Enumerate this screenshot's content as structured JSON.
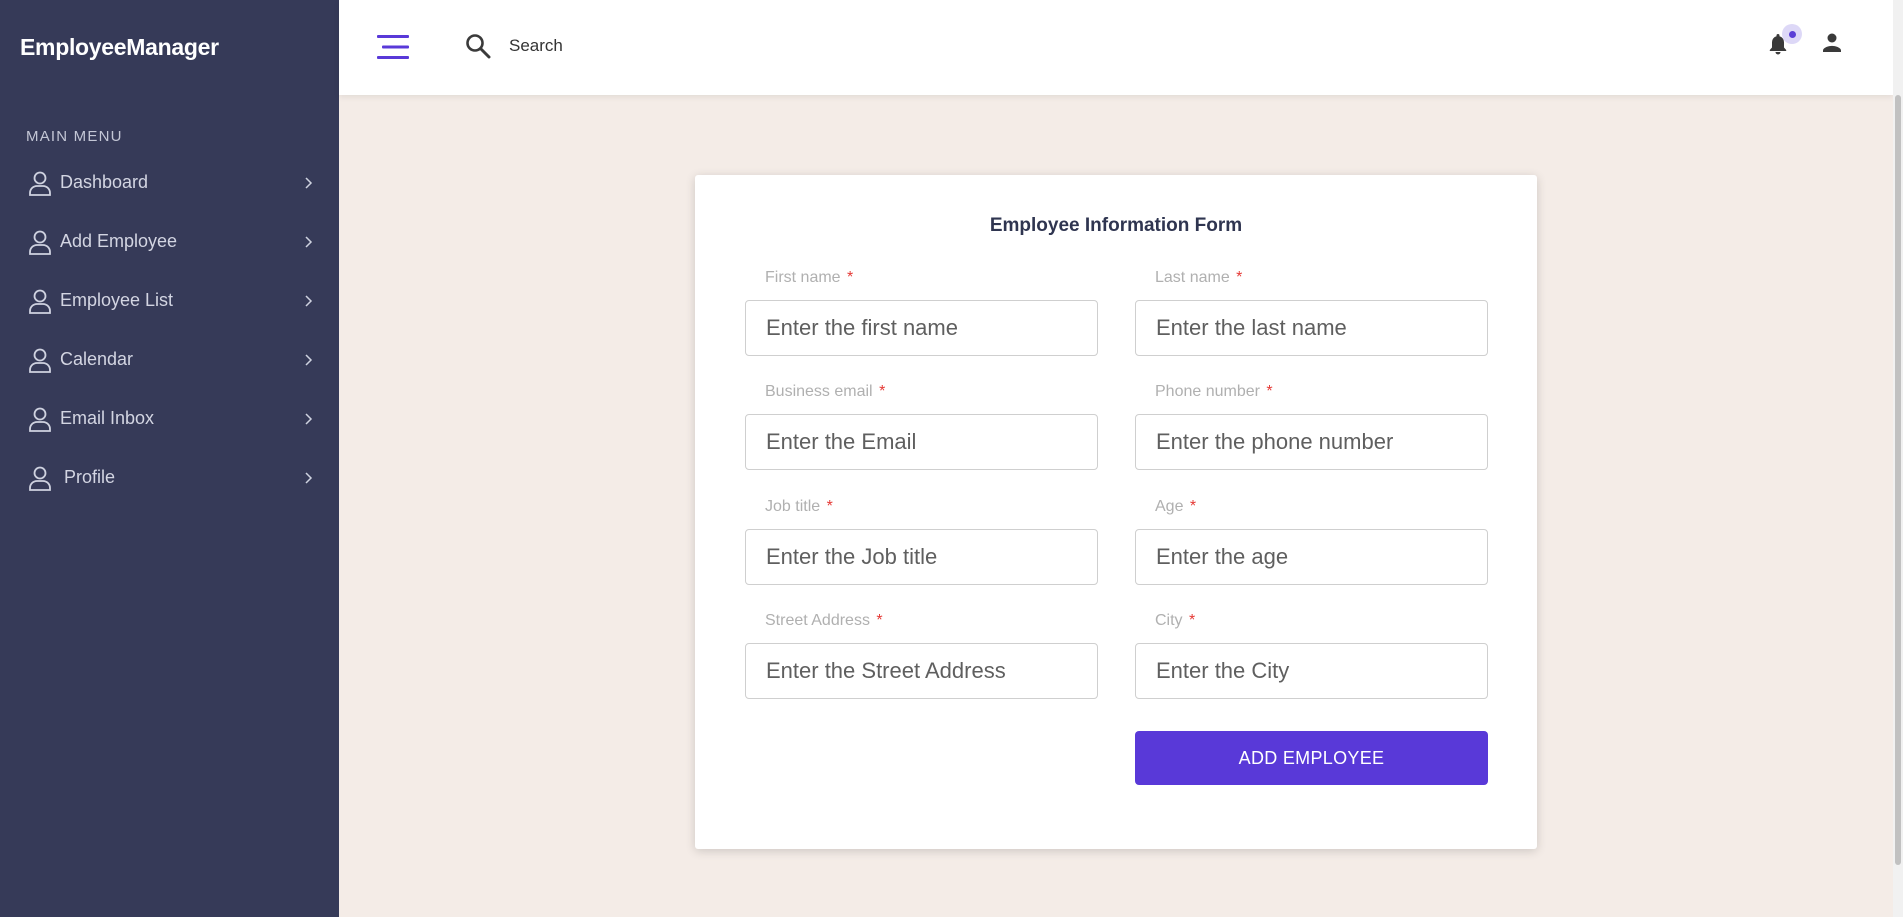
{
  "app": {
    "brand": "EmployeeManager"
  },
  "sidebar": {
    "heading": "MAIN MENU",
    "items": [
      {
        "label": "Dashboard",
        "icon": "user-icon"
      },
      {
        "label": "Add Employee",
        "icon": "user-icon"
      },
      {
        "label": "Employee List",
        "icon": "user-icon"
      },
      {
        "label": "Calendar",
        "icon": "user-icon"
      },
      {
        "label": "Email Inbox",
        "icon": "user-icon"
      },
      {
        "label": "Profile",
        "icon": "user-icon"
      }
    ]
  },
  "header": {
    "search_placeholder": "Search",
    "icons": [
      "menu-icon",
      "search-icon",
      "bell-icon",
      "person-icon"
    ]
  },
  "form": {
    "title": "Employee Information Form",
    "required_marker": "*",
    "fields": [
      {
        "label": "First name",
        "placeholder": "Enter the first name",
        "value": ""
      },
      {
        "label": "Last name",
        "placeholder": "Enter the last name",
        "value": ""
      },
      {
        "label": "Business email",
        "placeholder": "Enter the Email",
        "value": ""
      },
      {
        "label": "Phone number",
        "placeholder": "Enter the phone number",
        "value": ""
      },
      {
        "label": "Job title",
        "placeholder": "Enter the Job title",
        "value": ""
      },
      {
        "label": "Age",
        "placeholder": "Enter the age",
        "value": ""
      },
      {
        "label": "Street Address",
        "placeholder": "Enter the Street Address",
        "value": ""
      },
      {
        "label": "City",
        "placeholder": "Enter the City",
        "value": ""
      }
    ],
    "submit_label": "ADD EMPLOYEE"
  },
  "colors": {
    "sidebar_bg": "#363a58",
    "page_bg": "#f4ece7",
    "accent": "#5939d8",
    "required": "#e53935"
  }
}
